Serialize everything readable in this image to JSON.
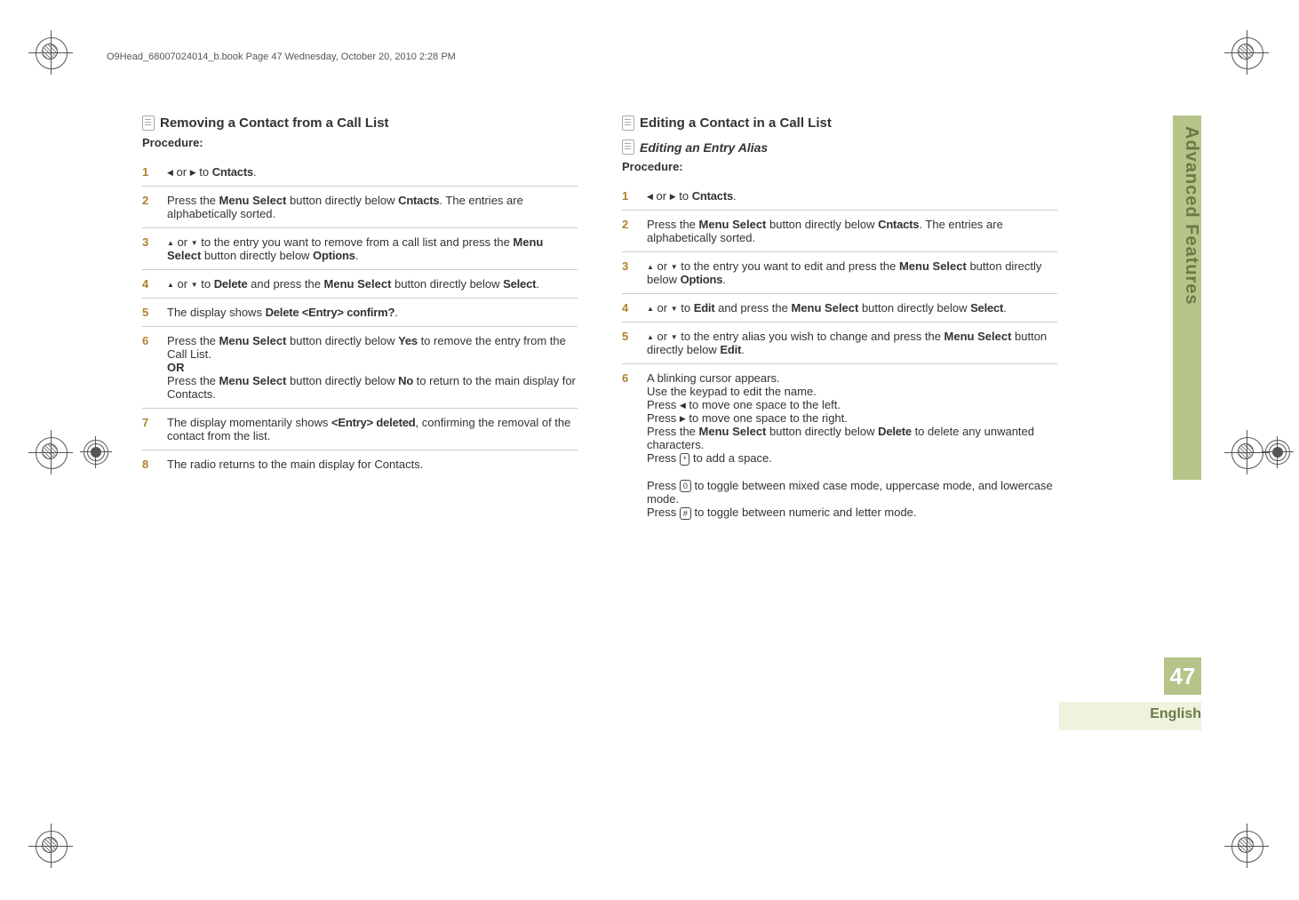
{
  "header": "O9Head_68007024014_b.book  Page 47  Wednesday, October 20, 2010  2:28 PM",
  "sideTab": "Advanced Features",
  "pageNumber": "47",
  "language": "English",
  "left": {
    "title": "Removing a Contact from a Call List",
    "procLabel": "Procedure:",
    "steps": [
      {
        "num": "1",
        "html": "<span class='arrow-l'></span> or <span class='arrow-r'></span> to <span class='mono'>Cntacts</span>."
      },
      {
        "num": "2",
        "html": "Press the <span class='bold'>Menu Select</span> button directly below <span class='mono'>Cntacts</span>. The entries are alphabetically sorted."
      },
      {
        "num": "3",
        "html": "<span class='arrow-u'></span> or <span class='arrow-d'></span> to the entry you want to remove from a call list and press the <span class='bold'>Menu Select</span> button directly below <span class='mono'>Options</span>."
      },
      {
        "num": "4",
        "html": "<span class='arrow-u'></span> or <span class='arrow-d'></span> to <span class='mono'>Delete</span> and press the <span class='bold'>Menu Select</span> button directly below <span class='mono'>Select</span>."
      },
      {
        "num": "5",
        "html": "The display shows <span class='mono'>Delete &lt;Entry&gt; confirm?</span>."
      },
      {
        "num": "6",
        "html": "Press the <span class='bold'>Menu Select</span> button directly below <span class='mono'>Yes</span> to remove the entry from the Call List.<br><span class='bold'>OR</span><br>Press the <span class='bold'>Menu Select</span> button directly below <span class='mono'>No</span> to return to the main display for Contacts."
      },
      {
        "num": "7",
        "html": "The display momentarily shows <span class='mono'>&lt;Entry&gt; deleted</span>, confirming the removal of the contact from the list."
      },
      {
        "num": "8",
        "html": "The radio returns to the main display for Contacts."
      }
    ]
  },
  "right": {
    "title": "Editing a Contact in a Call List",
    "subTitle": "Editing an Entry Alias",
    "procLabel": "Procedure:",
    "steps": [
      {
        "num": "1",
        "html": "<span class='arrow-l'></span> or <span class='arrow-r'></span> to <span class='mono'>Cntacts</span>."
      },
      {
        "num": "2",
        "html": "Press the <span class='bold'>Menu Select</span> button directly below <span class='mono'>Cntacts</span>. The entries are alphabetically sorted."
      },
      {
        "num": "3",
        "html": "<span class='arrow-u'></span> or <span class='arrow-d'></span> to the entry you want to edit and press the <span class='bold'>Menu Select</span> button directly below <span class='mono'>Options</span>."
      },
      {
        "num": "4",
        "html": "<span class='arrow-u'></span> or <span class='arrow-d'></span> to <span class='mono'>Edit</span> and press the <span class='bold'>Menu Select</span> button directly below <span class='mono'>Select</span>."
      },
      {
        "num": "5",
        "html": "<span class='arrow-u'></span> or <span class='arrow-d'></span> to the entry alias you wish to change and press the <span class='bold'>Menu Select</span> button directly below <span class='mono'>Edit</span>."
      },
      {
        "num": "6",
        "html": "A blinking cursor appears.<br>Use the keypad to edit the name.<br>Press <span class='arrow-l'></span> to move one space to the left.<br>Press <span class='arrow-r'></span> to move one space to the right.<br>Press the <span class='bold'>Menu Select</span> button directly below <span class='mono'>Delete</span> to delete any unwanted characters.<br>Press <span class='keybox'>*</span> to add a space.<br><br>Press <span class='keybox'>0</span> to toggle between mixed case mode, uppercase mode, and lowercase mode.<br>Press <span class='keybox'>#</span> to toggle between numeric and letter mode."
      }
    ]
  }
}
